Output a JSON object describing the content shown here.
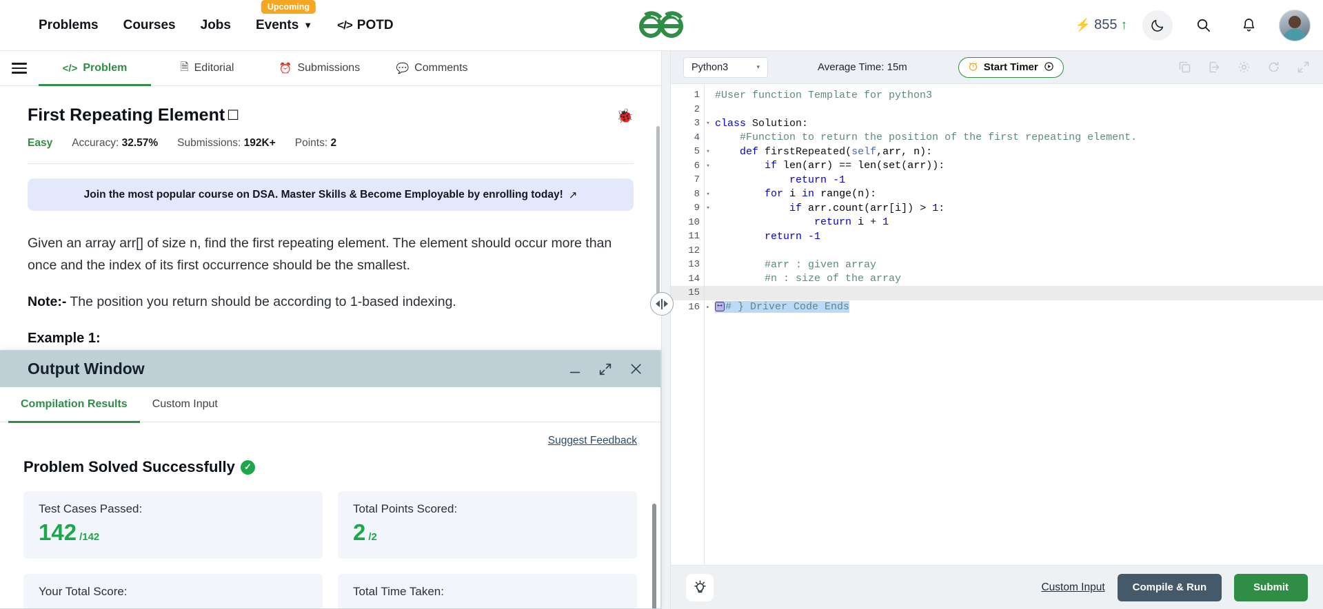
{
  "topnav": {
    "items": [
      {
        "label": "Problems",
        "icon": null,
        "badge": null
      },
      {
        "label": "Courses",
        "icon": null,
        "badge": null
      },
      {
        "label": "Jobs",
        "icon": null,
        "badge": null
      },
      {
        "label": "Events",
        "icon": "chevron-down-icon",
        "badge": "Upcoming"
      },
      {
        "label": "POTD",
        "icon": "code-icon",
        "badge": null
      }
    ],
    "logo_alt": "GeeksforGeeks",
    "score": "855",
    "score_bolt": "⚡",
    "score_arrow": "↑",
    "theme_icon": "moon-icon",
    "search_icon": "search-icon",
    "bell_icon": "bell-icon",
    "avatar_alt": "user-avatar"
  },
  "problem_tabs": [
    {
      "label": "Problem",
      "icon": "</>",
      "active": true
    },
    {
      "label": "Editorial",
      "icon": "🗎",
      "active": false
    },
    {
      "label": "Submissions",
      "icon": "◴",
      "active": false
    },
    {
      "label": "Comments",
      "icon": "💬",
      "active": false
    }
  ],
  "problem": {
    "title": "First Repeating Element",
    "bookmark_icon": "☐",
    "bug_icon": "🐞",
    "difficulty": "Easy",
    "accuracy_label": "Accuracy:",
    "accuracy_value": "32.57%",
    "submissions_label": "Submissions:",
    "submissions_value": "192K+",
    "points_label": "Points:",
    "points_value": "2",
    "promo_text": "Join the most popular course on DSA. Master Skills & Become Employable by enrolling today!",
    "promo_ext_icon": "↗",
    "description": "Given an array arr[] of size n, find the first repeating element. The element should occur more than once and the index of its first occurrence should be the smallest.",
    "note_label": "Note:-",
    "note_text": " The position you return should be according to 1-based indexing.",
    "example_heading": "Example 1:"
  },
  "output_window": {
    "title": "Output Window",
    "minimize_icon": "—",
    "expand_icon": "⤡",
    "close_icon": "✕",
    "tabs": [
      {
        "label": "Compilation Results",
        "active": true
      },
      {
        "label": "Custom Input",
        "active": false
      }
    ],
    "suggest_feedback": "Suggest Feedback",
    "status_text": "Problem Solved Successfully",
    "status_check": "✓",
    "cards": [
      {
        "label": "Test Cases Passed:",
        "value": "142",
        "suffix": "/142"
      },
      {
        "label": "Total Points Scored:",
        "value": "2",
        "suffix": "/2"
      },
      {
        "label": "Your Total Score:",
        "value": "",
        "suffix": ""
      },
      {
        "label": "Total Time Taken:",
        "value": "",
        "suffix": ""
      }
    ]
  },
  "editor": {
    "language": "Python3",
    "language_caret": "▾",
    "average_time": "Average Time: 15m",
    "timer_button": "Start Timer",
    "timer_clock_icon": "⏰",
    "timer_play_icon": "▶",
    "tool_icons": [
      "copy-icon",
      "import-icon",
      "gear-icon",
      "reset-icon",
      "fullscreen-icon"
    ],
    "bulb_icon": "💡",
    "custom_input_link": "Custom Input",
    "compile_button": "Compile & Run",
    "submit_button": "Submit",
    "code_lines": [
      {
        "n": "1",
        "fold": "",
        "html": "<span class=\"cm\">#User function Template for python3</span>"
      },
      {
        "n": "2",
        "fold": "",
        "html": ""
      },
      {
        "n": "3",
        "fold": "▾",
        "html": "<span class=\"kw\">class</span> <span class=\"fn\">Solution</span><span class=\"op\">:</span>"
      },
      {
        "n": "4",
        "fold": "",
        "html": "    <span class=\"cm\">#Function to return the position of the first repeating element.</span>"
      },
      {
        "n": "5",
        "fold": "▾",
        "html": "    <span class=\"kw\">def</span> <span class=\"fn\">firstRepeated</span><span class=\"op\">(</span><span class=\"param\">self</span><span class=\"op\">,</span>arr<span class=\"op\">,</span> n<span class=\"op\">):</span>"
      },
      {
        "n": "6",
        "fold": "▾",
        "html": "        <span class=\"kw\">if</span> len<span class=\"op\">(</span>arr<span class=\"op\">)</span> <span class=\"op\">==</span> len<span class=\"op\">(</span>set<span class=\"op\">(</span>arr<span class=\"op\">)):</span>"
      },
      {
        "n": "7",
        "fold": "",
        "html": "            <span class=\"kw\">return</span> <span class=\"num\">-1</span>"
      },
      {
        "n": "8",
        "fold": "▾",
        "html": "        <span class=\"kw\">for</span> i <span class=\"kw\">in</span> range<span class=\"op\">(</span>n<span class=\"op\">):</span>"
      },
      {
        "n": "9",
        "fold": "▾",
        "html": "            <span class=\"kw\">if</span> arr<span class=\"op\">.</span>count<span class=\"op\">(</span>arr<span class=\"op\">[</span>i<span class=\"op\">])</span> <span class=\"op\">&gt;</span> <span class=\"num\">1</span><span class=\"op\">:</span>"
      },
      {
        "n": "10",
        "fold": "",
        "html": "                <span class=\"kw\">return</span> i <span class=\"op\">+</span> <span class=\"num\">1</span>"
      },
      {
        "n": "11",
        "fold": "",
        "html": "        <span class=\"kw\">return</span> <span class=\"num\">-1</span>"
      },
      {
        "n": "12",
        "fold": "",
        "html": ""
      },
      {
        "n": "13",
        "fold": "",
        "html": "        <span class=\"cm\">#arr : given array</span>"
      },
      {
        "n": "14",
        "fold": "",
        "html": "        <span class=\"cm\">#n : size of the array</span>"
      },
      {
        "n": "15",
        "fold": "",
        "html": "",
        "highlight": true
      },
      {
        "n": "16",
        "fold": "▸",
        "html": "<span class=\"sel-line\"><span class=\"tab-glyph\">⟷</span><span class=\"cm\"># } Driver Code Ends</span></span>"
      }
    ]
  }
}
